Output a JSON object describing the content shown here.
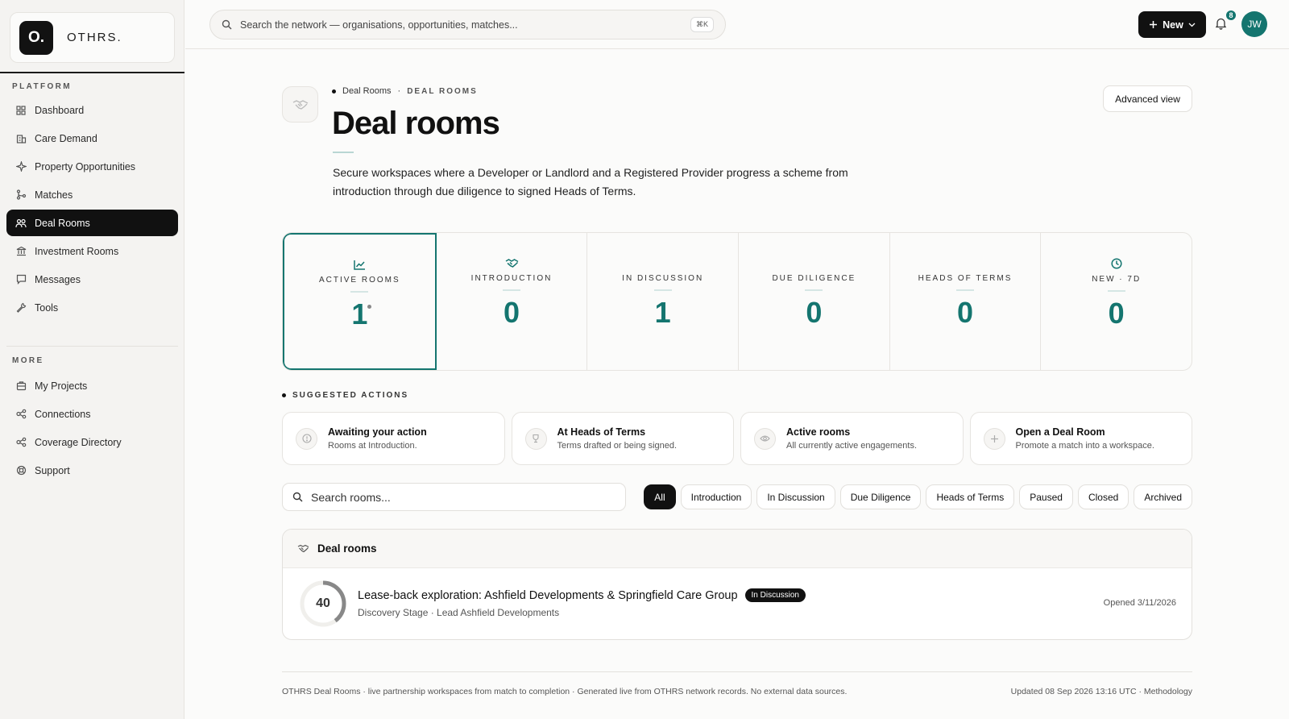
{
  "brand": {
    "logo": "O.",
    "name": "OTHRS."
  },
  "sidebar": {
    "platform_label": "PLATFORM",
    "platform_items": [
      {
        "label": "Dashboard",
        "icon": "grid-icon"
      },
      {
        "label": "Care Demand",
        "icon": "building-icon"
      },
      {
        "label": "Property Opportunities",
        "icon": "sparkle-icon"
      },
      {
        "label": "Matches",
        "icon": "branch-icon"
      },
      {
        "label": "Deal Rooms",
        "icon": "people-icon",
        "active": true
      },
      {
        "label": "Investment Rooms",
        "icon": "bank-icon"
      },
      {
        "label": "Messages",
        "icon": "message-icon"
      },
      {
        "label": "Tools",
        "icon": "wrench-icon"
      }
    ],
    "more_label": "MORE",
    "more_items": [
      {
        "label": "My Projects",
        "icon": "briefcase-icon"
      },
      {
        "label": "Connections",
        "icon": "network-icon"
      },
      {
        "label": "Coverage Directory",
        "icon": "network-icon"
      },
      {
        "label": "Support",
        "icon": "lifebuoy-icon"
      }
    ]
  },
  "topbar": {
    "search_placeholder": "Search the network — organisations, opportunities, matches...",
    "shortcut": "⌘K",
    "new_label": "New",
    "notifications_count": "8",
    "avatar_initials": "JW"
  },
  "page": {
    "breadcrumb": "Deal Rooms",
    "breadcrumb_sep": "·",
    "section_cap": "DEAL ROOMS",
    "title": "Deal rooms",
    "description": "Secure workspaces where a Developer or Landlord and a Registered Provider progress a scheme from introduction through due diligence to signed Heads of Terms.",
    "advanced_view": "Advanced view"
  },
  "stats": [
    {
      "label": "ACTIVE ROOMS",
      "value": "1",
      "icon": "trend-icon"
    },
    {
      "label": "INTRODUCTION",
      "value": "0",
      "icon": "handshake-icon"
    },
    {
      "label": "IN DISCUSSION",
      "value": "1",
      "icon": ""
    },
    {
      "label": "DUE DILIGENCE",
      "value": "0",
      "icon": ""
    },
    {
      "label": "HEADS OF TERMS",
      "value": "0",
      "icon": ""
    },
    {
      "label": "NEW · 7D",
      "value": "0",
      "icon": "clock-icon"
    }
  ],
  "suggested": {
    "label": "SUGGESTED ACTIONS",
    "items": [
      {
        "title": "Awaiting your action",
        "subtitle": "Rooms at Introduction.",
        "icon": "alert-icon"
      },
      {
        "title": "At Heads of Terms",
        "subtitle": "Terms drafted or being signed.",
        "icon": "trophy-icon"
      },
      {
        "title": "Active rooms",
        "subtitle": "All currently active engagements.",
        "icon": "eye-icon"
      },
      {
        "title": "Open a Deal Room",
        "subtitle": "Promote a match into a workspace.",
        "icon": "plus-icon"
      }
    ]
  },
  "rooms_search_placeholder": "Search rooms...",
  "filters": [
    "All",
    "Introduction",
    "In Discussion",
    "Due Diligence",
    "Heads of Terms",
    "Paused",
    "Closed",
    "Archived"
  ],
  "rooms": {
    "heading": "Deal rooms",
    "rows": [
      {
        "progress": 40,
        "progress_label": "40",
        "title": "Lease-back exploration: Ashfield Developments & Springfield Care Group",
        "status": "In Discussion",
        "subtitle": "Discovery Stage · Lead Ashfield Developments",
        "opened": "Opened 3/11/2026"
      }
    ]
  },
  "footer": {
    "left": "OTHRS Deal Rooms · live partnership workspaces from match to completion · Generated live from OTHRS network records. No external data sources.",
    "right": "Updated 08 Sep 2026 13:16 UTC · Methodology"
  },
  "colors": {
    "accent": "#14756f",
    "dark": "#111111"
  }
}
